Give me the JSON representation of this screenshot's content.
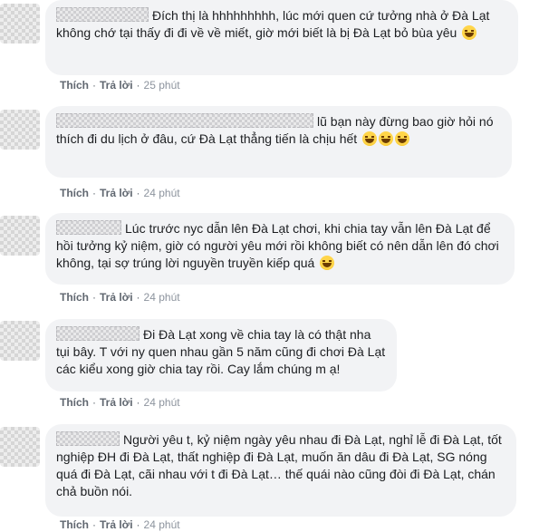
{
  "actions": {
    "like": "Thích",
    "reply": "Trả lời",
    "separator": "·"
  },
  "comments": [
    {
      "text": "Đích thị là hhhhhhhhh, lúc mới quen cứ tưởng nhà ở Đà Lạt không chớ tại thấy đi đi về về miết, giờ mới biết là bị Đà Lạt bỏ bùa yêu",
      "emoji": "laughing-crying-emoji",
      "time": "25 phút"
    },
    {
      "text": "lũ bạn này đừng bao giờ hỏi nó thích đi du lịch ở đâu, cứ Đà Lạt thẳng tiến là chịu hết",
      "emoji": "laughing-crying-emoji x3",
      "time": "24 phút"
    },
    {
      "text": "Lúc trước nyc dẫn lên Đà Lạt chơi, khi chia tay vẫn lên Đà Lạt để hồi tưởng kỷ niệm, giờ có người yêu mới rồi không biết có nên dẫn lên đó chơi không, tại sợ trúng lời nguyền truyền kiếp quá",
      "emoji": "laughing-crying-emoji",
      "time": "24 phút"
    },
    {
      "text": "Đi Đà Lạt xong về chia tay là có thật nha tụi bây. T với ny quen nhau gần 5 năm cũng đi chơi Đà Lạt các kiểu xong giờ chia tay rồi. Cay lắm chúng m ạ!",
      "time": "24 phút"
    },
    {
      "text": "Người yêu t, kỷ niệm ngày yêu nhau đi Đà Lạt, nghỉ lễ đi Đà Lạt, tốt nghiệp ĐH đi Đà Lạt, thất nghiệp đi Đà Lạt, muốn ăn dâu đi Đà Lạt, SG nóng quá đi Đà Lạt, cãi nhau với t đi Đà Lạt… thế quái nào cũng đòi đi Đà Lạt, chán chả buồn nói.",
      "time": "24 phút"
    }
  ]
}
